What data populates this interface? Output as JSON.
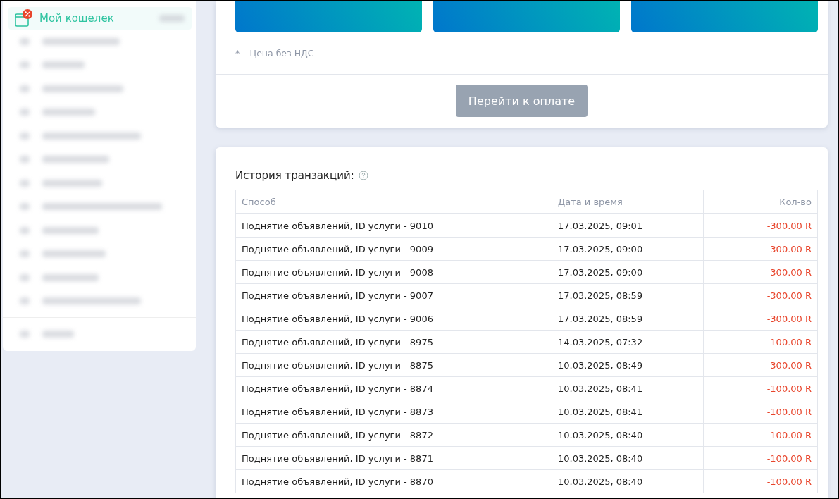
{
  "sidebar": {
    "items": [
      {
        "label": "Мой кошелек",
        "selected": true
      }
    ]
  },
  "payment": {
    "note": "* – Цена без НДС",
    "button": "Перейти к оплате"
  },
  "transactions": {
    "title": "История транзакций:",
    "columns": [
      "Способ",
      "Дата и время",
      "Кол-во"
    ],
    "rows": [
      {
        "method": "Поднятие объявлений, ID услуги - 9010",
        "date": "17.03.2025, 09:01",
        "amount": "-300.00 R"
      },
      {
        "method": "Поднятие объявлений, ID услуги - 9009",
        "date": "17.03.2025, 09:00",
        "amount": "-300.00 R"
      },
      {
        "method": "Поднятие объявлений, ID услуги - 9008",
        "date": "17.03.2025, 09:00",
        "amount": "-300.00 R"
      },
      {
        "method": "Поднятие объявлений, ID услуги - 9007",
        "date": "17.03.2025, 08:59",
        "amount": "-300.00 R"
      },
      {
        "method": "Поднятие объявлений, ID услуги - 9006",
        "date": "17.03.2025, 08:59",
        "amount": "-300.00 R"
      },
      {
        "method": "Поднятие объявлений, ID услуги - 8975",
        "date": "14.03.2025, 07:32",
        "amount": "-100.00 R"
      },
      {
        "method": "Поднятие объявлений, ID услуги - 8875",
        "date": "10.03.2025, 08:49",
        "amount": "-300.00 R"
      },
      {
        "method": "Поднятие объявлений, ID услуги - 8874",
        "date": "10.03.2025, 08:41",
        "amount": "-100.00 R"
      },
      {
        "method": "Поднятие объявлений, ID услуги - 8873",
        "date": "10.03.2025, 08:41",
        "amount": "-100.00 R"
      },
      {
        "method": "Поднятие объявлений, ID услуги - 8872",
        "date": "10.03.2025, 08:40",
        "amount": "-100.00 R"
      },
      {
        "method": "Поднятие объявлений, ID услуги - 8871",
        "date": "10.03.2025, 08:40",
        "amount": "-100.00 R"
      },
      {
        "method": "Поднятие объявлений, ID услуги - 8870",
        "date": "10.03.2025, 08:40",
        "amount": "-100.00 R"
      }
    ]
  }
}
